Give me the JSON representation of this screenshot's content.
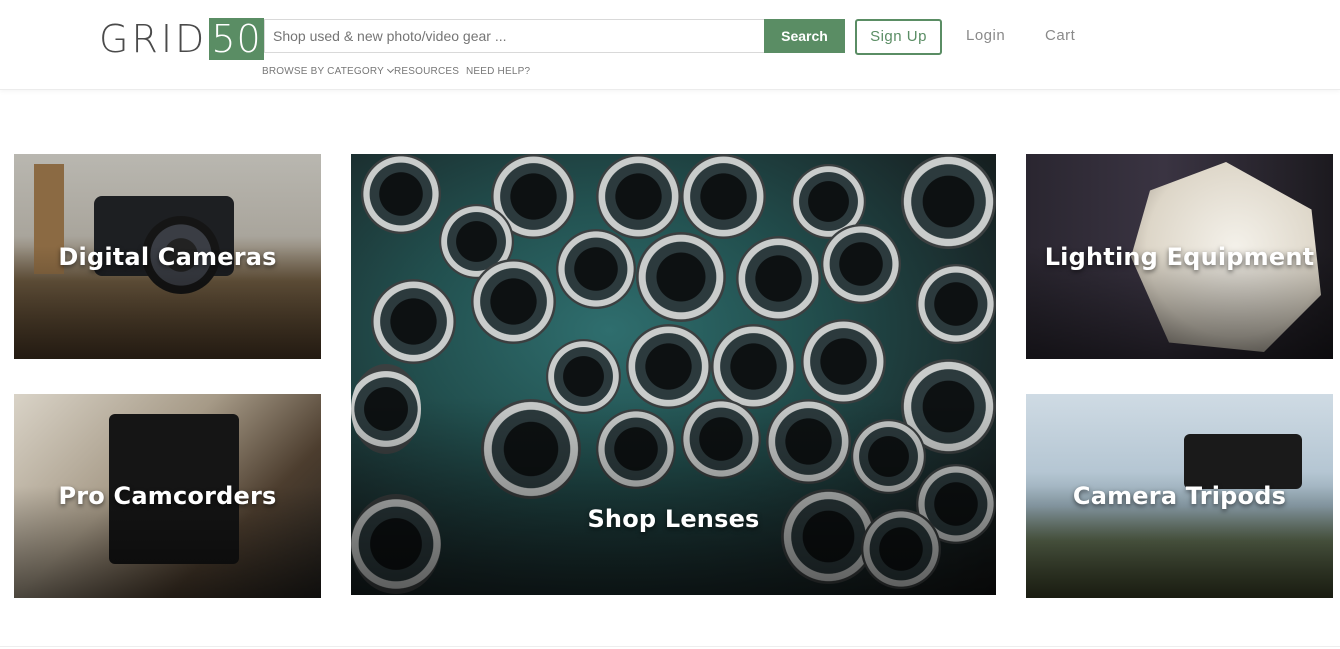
{
  "header": {
    "logo_text": "GRID",
    "logo_number": "50",
    "search_placeholder": "Shop used & new photo/video gear ...",
    "search_label": "Search",
    "signup_label": "Sign Up",
    "login_label": "Login",
    "cart_label": "Cart",
    "subnav": {
      "browse_label": "BROWSE BY CATEGORY",
      "resources_label": "RESOURCES",
      "help_label": "NEED HELP?"
    }
  },
  "categories": {
    "digital_cameras": "Digital Cameras",
    "pro_camcorders": "Pro Camcorders",
    "shop_lenses": "Shop Lenses",
    "lighting_equipment": "Lighting Equipment",
    "camera_tripods": "Camera Tripods"
  },
  "colors": {
    "brand_green": "#5a8d64",
    "text_gray": "#8a8a8a"
  }
}
